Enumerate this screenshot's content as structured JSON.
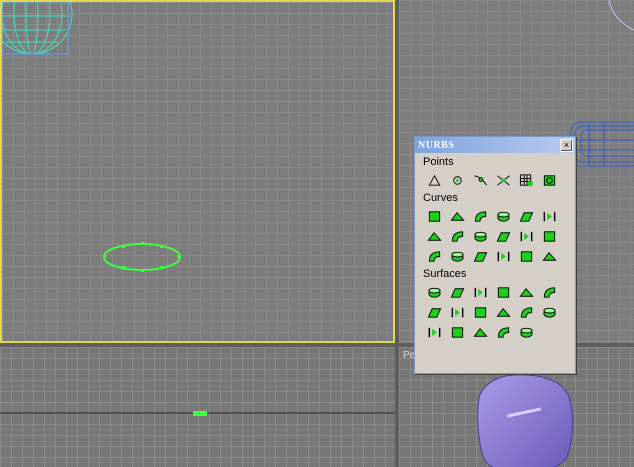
{
  "toolbar": {
    "title": "NURBS",
    "close_label": "×",
    "sections": {
      "points": "Points",
      "curves": "Curves",
      "surfaces": "Surfaces"
    },
    "points_tools": [
      "create-point",
      "point-on-curve",
      "curve-point",
      "cv-point",
      "surface-point",
      "surf-cv-point"
    ],
    "curves_tools": [
      "cv-curve",
      "point-curve",
      "fit-curve",
      "transform-curve",
      "blend-curve",
      "offset-curve",
      "mirror-curve",
      "chamfer-curve",
      "fillet-curve",
      "surf-surf-intersect",
      "u-iso-curve",
      "v-iso-curve",
      "normal-proj-curve",
      "vector-proj-curve",
      "cv-curve-on-surf",
      "point-curve-on-surf",
      "surf-offset-curve",
      "surf-edge-curve"
    ],
    "surfaces_tools": [
      "cv-surface",
      "point-surface",
      "transform-surface",
      "blend-surface",
      "offset-surface",
      "mirror-surface",
      "extrude-surface",
      "lathe-surface",
      "ruled-surface",
      "cap-surface",
      "u-loft-surface",
      "uv-loft-surface",
      "1-rail-sweep",
      "2-rail-sweep",
      "multisided-blend",
      "multicurve-trim",
      "fillet-surface"
    ]
  },
  "viewports": {
    "perspective_label": "Pe"
  },
  "colors": {
    "active_border": "#e4d84a",
    "selected_spline": "#3cff3c",
    "wire_cyan": "#40e0c0",
    "wire_blue": "#3060d0",
    "shaded_purple": "#8a7ad0",
    "toolbar_bg": "#d4d0c8",
    "titlebar": "#7fa2dc"
  }
}
